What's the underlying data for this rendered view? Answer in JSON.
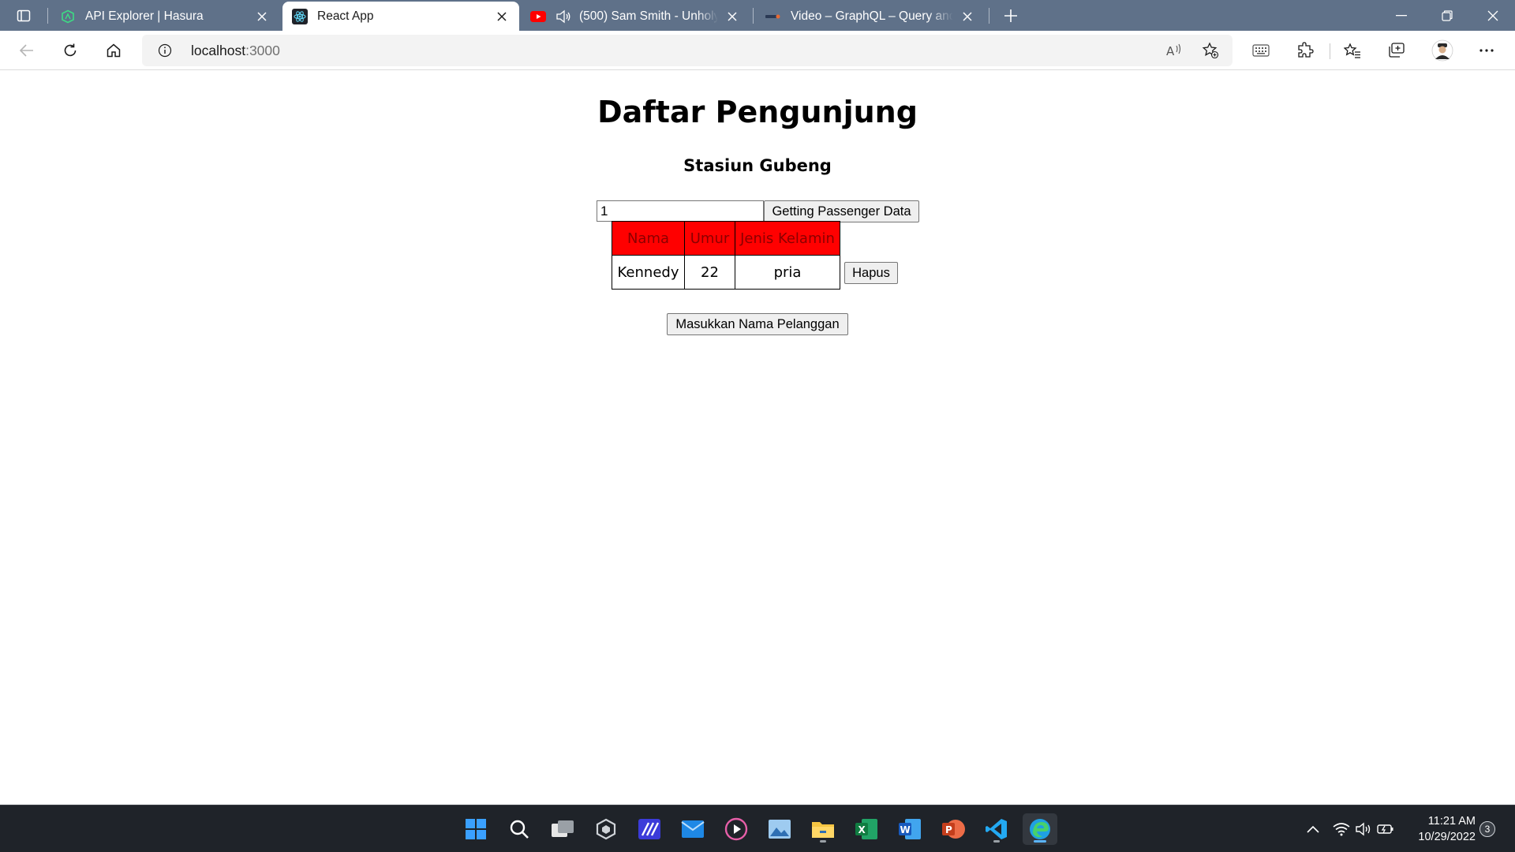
{
  "browser": {
    "tabs": [
      {
        "title": "API Explorer | Hasura",
        "favicon": "hasura-icon",
        "active": false
      },
      {
        "title": "React App",
        "favicon": "react-icon",
        "active": true
      },
      {
        "title": "(500) Sam Smith - Unholy (",
        "favicon": "youtube-icon",
        "active": false,
        "playing_audio": true
      },
      {
        "title": "Video – GraphQL – Query and A",
        "favicon": "video-site-icon",
        "active": false
      }
    ],
    "url_host": "localhost",
    "url_port": ":3000"
  },
  "page": {
    "title": "Daftar Pengunjung",
    "subtitle": "Stasiun Gubeng",
    "id_input_value": "1",
    "fetch_button_label": "Getting Passenger Data",
    "table": {
      "headers": [
        "Nama",
        "Umur",
        "Jenis Kelamin"
      ],
      "rows": [
        {
          "nama": "Kennedy",
          "umur": "22",
          "jenis_kelamin": "pria",
          "delete_label": "Hapus"
        }
      ]
    },
    "add_button_label": "Masukkan Nama Pelanggan"
  },
  "taskbar": {
    "apps": [
      "start-icon",
      "search-icon",
      "task-view-icon",
      "unity-hub-icon",
      "app-icon",
      "mail-icon",
      "media-player-icon",
      "photos-icon",
      "file-explorer-icon",
      "excel-icon",
      "word-icon",
      "powerpoint-icon",
      "vscode-icon",
      "edge-icon"
    ],
    "time": "11:21 AM",
    "date": "10/29/2022",
    "notification_count": "3"
  },
  "colors": {
    "tabstrip": "#5f7189",
    "table_header_bg": "#ff0000",
    "table_header_text": "#8b0000",
    "taskbar": "#1f2329"
  }
}
